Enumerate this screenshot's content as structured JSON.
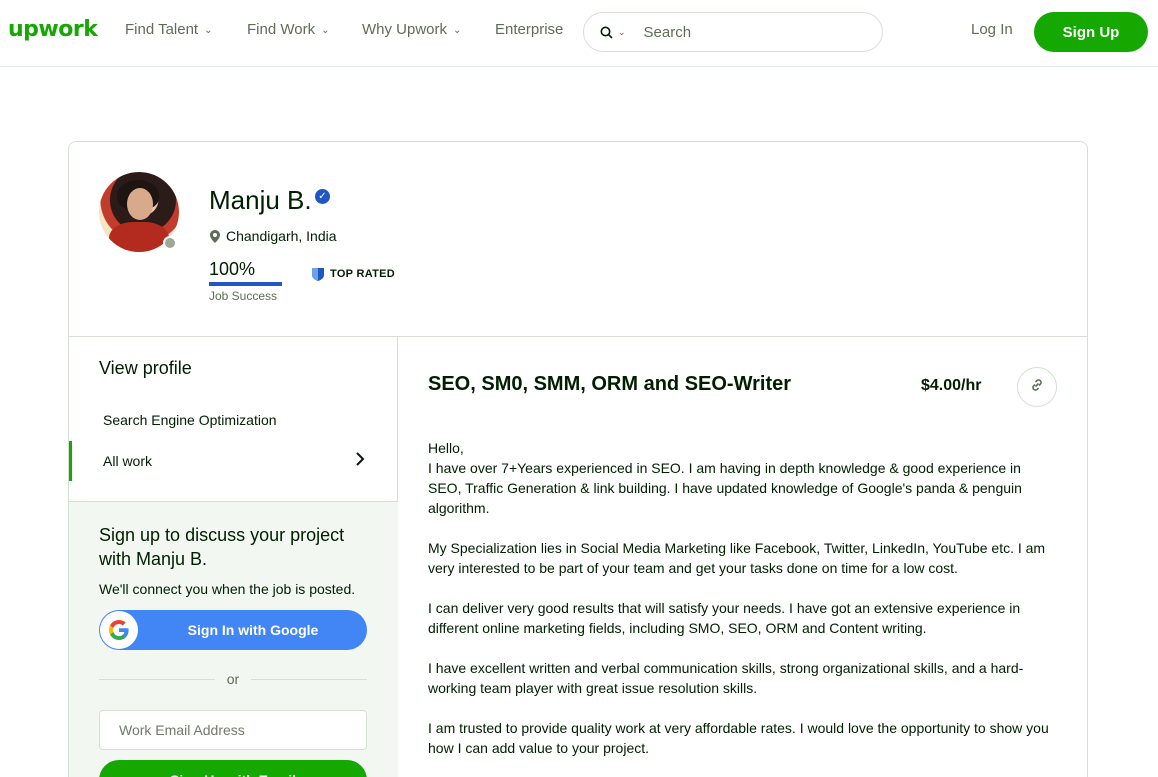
{
  "header": {
    "logo": "upwork",
    "nav": [
      "Find Talent",
      "Find Work",
      "Why Upwork",
      "Enterprise"
    ],
    "search_placeholder": "Search",
    "login": "Log In",
    "signup": "Sign Up"
  },
  "profile": {
    "name": "Manju B.",
    "location": "Chandigarh, India",
    "job_success_value": "100%",
    "job_success_fraction": 1.0,
    "job_success_label": "Job Success",
    "badge": "TOP RATED"
  },
  "sidebar": {
    "view_profile": "View profile",
    "items": [
      "Search Engine Optimization",
      "All work"
    ],
    "signup_title": "Sign up to discuss your project with Manju B.",
    "signup_sub": "We'll connect you when the job is posted.",
    "google_button": "Sign In with Google",
    "or_text": "or",
    "email_placeholder": "Work Email Address",
    "email_button": "Sign Up with Email"
  },
  "main": {
    "title": "SEO, SM0, SMM, ORM and SEO-Writer",
    "rate": "$4.00/hr",
    "description": [
      "Hello,\nI have over 7+Years experienced in SEO. I am having in depth knowledge & good experience in SEO, Traffic Generation & link building. I have updated knowledge of Google's panda & penguin algorithm.",
      "My Specialization lies in Social Media Marketing like Facebook, Twitter, LinkedIn, YouTube etc. I am very interested to be part of your team and get your tasks done on time for a low cost.",
      "I can deliver very good results that will satisfy your needs. I have got an extensive experience in different online marketing fields, including SMO, SEO, ORM and Content writing.",
      "I have excellent written and verbal communication skills, strong organizational skills, and a hard-working team player with great issue resolution skills.",
      "I am trusted to provide quality work at very affordable rates. I would love the opportunity to show you how I can add value to your project."
    ]
  },
  "colors": {
    "brand_green": "#14a800",
    "verified_blue": "#1f57c3",
    "google_blue": "#4285f4"
  }
}
